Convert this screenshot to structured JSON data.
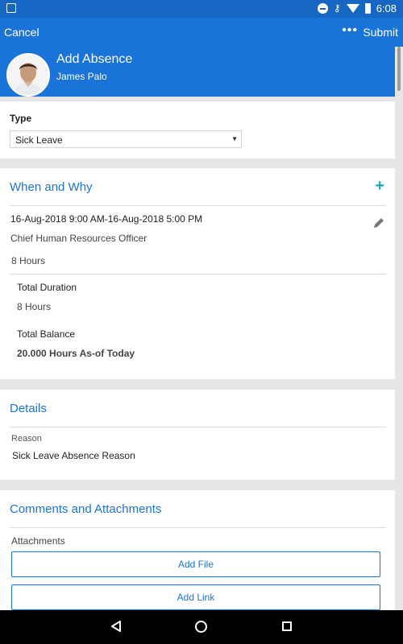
{
  "status_bar": {
    "time": "6:08"
  },
  "app_bar": {
    "cancel": "Cancel",
    "more": "•••",
    "submit": "Submit"
  },
  "header": {
    "title": "Add Absence",
    "name": "James Palo"
  },
  "type_section": {
    "label": "Type",
    "selected": "Sick Leave"
  },
  "when_why": {
    "title": "When and Why",
    "add": "+",
    "entry": {
      "dates": "16-Aug-2018 9:00 AM-16-Aug-2018 5:00 PM",
      "role": "Chief Human Resources Officer",
      "hours": "8 Hours"
    },
    "total_duration_label": "Total Duration",
    "total_duration_value": "8 Hours",
    "total_balance_label": "Total Balance",
    "total_balance_value": "20.000 Hours As-of Today"
  },
  "details": {
    "title": "Details",
    "reason_label": "Reason",
    "reason_value": "Sick Leave Absence Reason"
  },
  "comments": {
    "title": "Comments and Attachments",
    "attachments_label": "Attachments",
    "add_file": "Add File",
    "add_link": "Add Link"
  },
  "colors": {
    "primary": "#1a73d9",
    "accent": "#1ba7b8"
  }
}
